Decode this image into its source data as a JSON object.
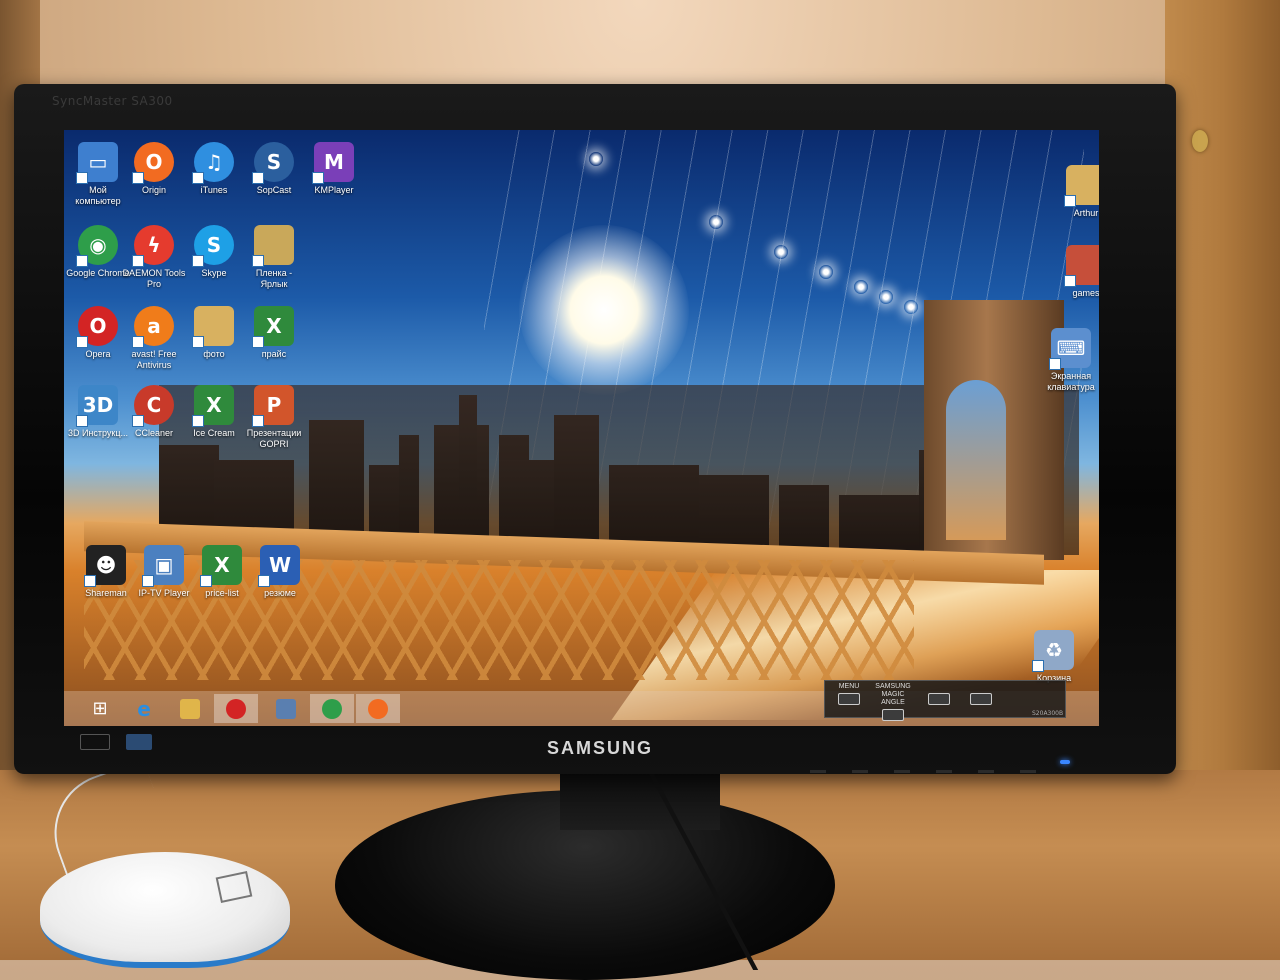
{
  "monitor": {
    "brand": "SAMSUNG",
    "model": "SyncMaster SA300",
    "osd": {
      "menu_label": "MENU",
      "magic_angle_label": "SAMSUNG MAGIC ANGLE",
      "model_text": "S20A300B"
    }
  },
  "desktop": {
    "icons_left": [
      {
        "label": "Мой компьютер",
        "icon": "computer-icon",
        "color": "#3e7fcf"
      },
      {
        "label": "Origin",
        "icon": "origin-icon",
        "color": "#f26b21"
      },
      {
        "label": "iTunes",
        "icon": "itunes-icon",
        "color": "#2f8fe0"
      },
      {
        "label": "SopCast",
        "icon": "sopcast-icon",
        "color": "#2b5f9e"
      },
      {
        "label": "KMPlayer",
        "icon": "kmplayer-icon",
        "color": "#7a3fb8"
      },
      {
        "label": "Google Chrome",
        "icon": "chrome-icon",
        "color": "#2e9e4a"
      },
      {
        "label": "DAEMON Tools Pro",
        "icon": "daemon-tools-icon",
        "color": "#e53b2e"
      },
      {
        "label": "Skype",
        "icon": "skype-icon",
        "color": "#1ea0e6"
      },
      {
        "label": "Пленка - Ярлык",
        "icon": "folder-icon",
        "color": "#c9a85a"
      },
      {
        "label": "Opera",
        "icon": "opera-icon",
        "color": "#d32424"
      },
      {
        "label": "avast! Free Antivirus",
        "icon": "avast-icon",
        "color": "#f07c1a"
      },
      {
        "label": "фото",
        "icon": "folder-icon",
        "color": "#d8b160"
      },
      {
        "label": "прайс",
        "icon": "excel-icon",
        "color": "#2f8a3c"
      },
      {
        "label": "3D Инструкц...",
        "icon": "3d-icon",
        "color": "#3d86c8"
      },
      {
        "label": "CCleaner",
        "icon": "ccleaner-icon",
        "color": "#c83a2a"
      },
      {
        "label": "Ice Cream",
        "icon": "excel-icon",
        "color": "#2f8a3c"
      },
      {
        "label": "Презентации GOPRI",
        "icon": "powerpoint-icon",
        "color": "#d2552b"
      },
      {
        "label": "Shareman",
        "icon": "shareman-icon",
        "color": "#222222"
      },
      {
        "label": "IP-TV Player",
        "icon": "iptv-icon",
        "color": "#4b80c0"
      },
      {
        "label": "price-list",
        "icon": "excel-icon",
        "color": "#2f8a3c"
      },
      {
        "label": "резюме",
        "icon": "word-icon",
        "color": "#2b5fb4"
      }
    ],
    "icons_right": [
      {
        "label": "Arthur",
        "icon": "folder-icon",
        "color": "#d8b160"
      },
      {
        "label": "games",
        "icon": "folder-icon",
        "color": "#c64f3a"
      },
      {
        "label": "Экранная клавиатура",
        "icon": "keyboard-icon",
        "color": "#5c8fcf"
      },
      {
        "label": "Корзина",
        "icon": "recycle-bin-icon",
        "color": "#8fa8c8"
      }
    ]
  },
  "taskbar": {
    "items": [
      {
        "name": "start",
        "icon": "windows-icon",
        "color": "#ffffff"
      },
      {
        "name": "ie",
        "icon": "internet-explorer-icon",
        "color": "#2c8ee0"
      },
      {
        "name": "explorer",
        "icon": "folder-icon",
        "color": "#e0b54a"
      },
      {
        "name": "opera",
        "icon": "opera-icon",
        "color": "#d32424"
      },
      {
        "name": "network",
        "icon": "network-icon",
        "color": "#5a7fb0"
      },
      {
        "name": "chrome",
        "icon": "chrome-icon",
        "color": "#2e9e4a"
      },
      {
        "name": "origin",
        "icon": "origin-icon",
        "color": "#f26b21"
      }
    ]
  }
}
